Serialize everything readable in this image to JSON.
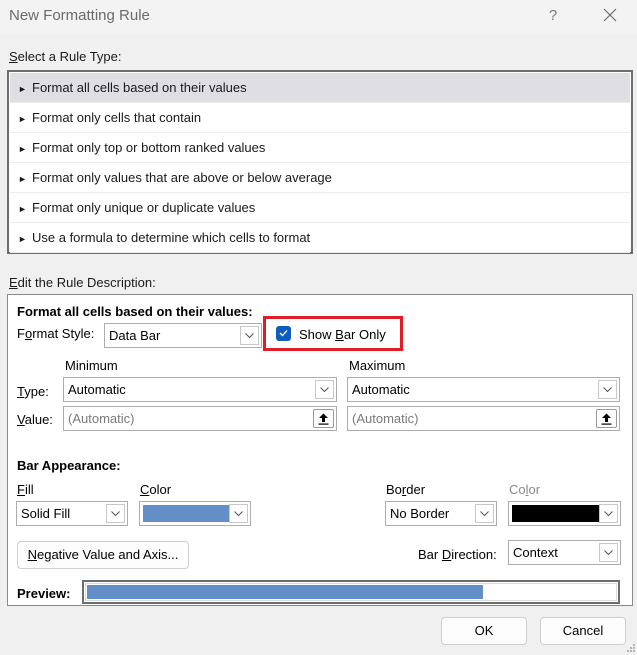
{
  "window": {
    "title": "New Formatting Rule",
    "help_label": "?",
    "close_icon": "close-icon"
  },
  "rule_type": {
    "label": "Select a Rule Type:",
    "label_accesskey": "S",
    "label_rest": "elect a Rule Type:",
    "selected_index": 0,
    "items": [
      {
        "label": "Format all cells based on their values"
      },
      {
        "label": "Format only cells that contain"
      },
      {
        "label": "Format only top or bottom ranked values"
      },
      {
        "label": "Format only values that are above or below average"
      },
      {
        "label": "Format only unique or duplicate values"
      },
      {
        "label": "Use a formula to determine which cells to format"
      }
    ],
    "item_icon": "triangle-right-icon"
  },
  "description": {
    "label_accesskey": "E",
    "label_rest": "dit the Rule Description:",
    "heading": "Format all cells based on their values:",
    "format_style": {
      "label_pre": "F",
      "label_accesskey": "o",
      "label_post": "rmat Style:",
      "value": "Data Bar"
    },
    "show_bar_only": {
      "label_pre": "Show ",
      "label_accesskey": "B",
      "label_post": "ar Only",
      "checked": true
    },
    "minimum": {
      "heading": "Minimum",
      "type_value": "Automatic",
      "value_placeholder": "(Automatic)"
    },
    "maximum": {
      "heading": "Maximum",
      "type_value": "Automatic",
      "value_placeholder": "(Automatic)"
    },
    "type_label_accesskey": "T",
    "type_label_rest": "ype:",
    "value_label_accesskey": "V",
    "value_label_rest": "alue:",
    "bar_appearance": {
      "heading": "Bar Appearance:",
      "fill_label_accesskey": "F",
      "fill_label_rest": "ill",
      "fill_value": "Solid Fill",
      "fill_color_label_accesskey": "C",
      "fill_color_label_rest": "olor",
      "fill_color": "#638ec6",
      "border_label_pre": "Bo",
      "border_label_accesskey": "r",
      "border_label_post": "der",
      "border_value": "No Border",
      "border_color_label_pre": "Co",
      "border_color_label_accesskey": "l",
      "border_color_label_post": "or",
      "border_color": "#000000",
      "negative_button_accesskey": "N",
      "negative_button_rest": "egative Value and Axis...",
      "direction_label_pre": "Bar ",
      "direction_label_accesskey": "D",
      "direction_label_post": "irection:",
      "direction_value": "Context"
    },
    "preview": {
      "label": "Preview:",
      "fill_fraction": 0.75,
      "fill_color": "#638ec6"
    }
  },
  "footer": {
    "ok_label": "OK",
    "cancel_label": "Cancel"
  },
  "colors": {
    "highlight_box": "#e01d25",
    "checkbox_accent": "#0f5cbd",
    "selected_row": "#dfdfe3"
  }
}
